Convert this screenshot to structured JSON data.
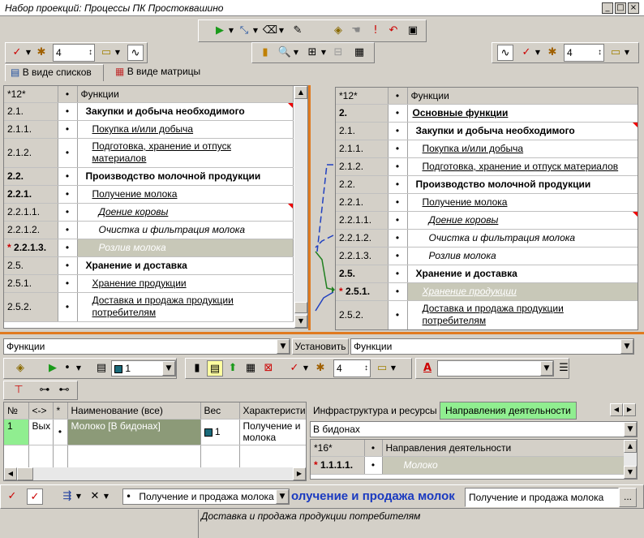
{
  "window": {
    "title": "Набор проекций: Процессы ПК Простоквашино",
    "min": "_",
    "max": "□",
    "close": "×"
  },
  "toolbar_top": {
    "spin_value": "4"
  },
  "toolbar_right": {
    "spin_value": "4"
  },
  "tabs": [
    {
      "label": "В виде списков"
    },
    {
      "label": "В виде матрицы"
    }
  ],
  "left_grid": {
    "header": {
      "num": "*12*",
      "bullet": "•",
      "name": "Функции"
    },
    "rows": [
      {
        "num": "2.1.",
        "name": "Закупки и добыча необходимого"
      },
      {
        "num": "2.1.1.",
        "name": "Покупка и/или добыча"
      },
      {
        "num": "2.1.2.",
        "name": "Подготовка, хранение и отпуск",
        "name2": "материалов"
      },
      {
        "num": "2.2.",
        "name": "Производство молочной продукции"
      },
      {
        "num": "2.2.1.",
        "name": "Получение молока"
      },
      {
        "num": "2.2.1.1.",
        "name": "Доение коровы"
      },
      {
        "num": "2.2.1.2.",
        "name": "Очистка и фильтрация молока"
      },
      {
        "num": "2.2.1.3.",
        "name": "Розлив молока",
        "marker": "*"
      },
      {
        "num": "2.5.",
        "name": "Хранение и доставка"
      },
      {
        "num": "2.5.1.",
        "name": "Хранение продукции"
      },
      {
        "num": "2.5.2.",
        "name": "Доставка и продажа продукции",
        "name2": "потребителям"
      }
    ]
  },
  "right_grid": {
    "header": {
      "num": "*12*",
      "bullet": "•",
      "name": "Функции"
    },
    "rows": [
      {
        "num": "2.",
        "name": "Основные функции"
      },
      {
        "num": "2.1.",
        "name": "Закупки и добыча необходимого"
      },
      {
        "num": "2.1.1.",
        "name": "Покупка и/или добыча"
      },
      {
        "num": "2.1.2.",
        "name": "Подготовка, хранение и отпуск материалов"
      },
      {
        "num": "2.2.",
        "name": "Производство молочной продукции"
      },
      {
        "num": "2.2.1.",
        "name": "Получение молока"
      },
      {
        "num": "2.2.1.1.",
        "name": "Доение коровы"
      },
      {
        "num": "2.2.1.2.",
        "name": "Очистка и фильтрация молока"
      },
      {
        "num": "2.2.1.3.",
        "name": "Розлив молока"
      },
      {
        "num": "2.5.",
        "name": "Хранение и доставка"
      },
      {
        "num": "2.5.1.",
        "name": "Хранение продукции",
        "marker": "*"
      },
      {
        "num": "2.5.2.",
        "name": "Доставка и продажа продукции",
        "name2": "потребителям"
      }
    ]
  },
  "filter_left": {
    "value": "Функции"
  },
  "filter_right": {
    "value": "Функции",
    "button": "Установить"
  },
  "bottom_toolbar": {
    "model_value": "1",
    "spin_value": "4"
  },
  "detail_table": {
    "headers": [
      "№",
      "<->",
      "*",
      "Наименование (все)",
      "Вес",
      "Характеристики"
    ],
    "row": {
      "num": "1",
      "dir": "Вых",
      "bullet": "•",
      "name": "Молоко [В бидонах]",
      "weight": "1",
      "char1": "Получение и",
      "char2": "молока"
    }
  },
  "right_tabs": [
    {
      "label": "Инфраструктура и ресурсы"
    },
    {
      "label": "Направления деятельности"
    }
  ],
  "right_combo": {
    "value": "В бидонах"
  },
  "right_small_grid": {
    "header": {
      "num": "*16*",
      "bullet": "•",
      "name": "Направления деятельности"
    },
    "row": {
      "marker": "*",
      "num": "1.1.1.1.",
      "bullet": "•",
      "name": "Молоко"
    }
  },
  "status_bar": {
    "combo": "Получение и продажа молока",
    "big_text": "олучение и продажа молок",
    "field": "Получение и продажа молока",
    "ellipsis": "..."
  },
  "footer": {
    "text": "Доставка и продажа продукции потребителям"
  }
}
